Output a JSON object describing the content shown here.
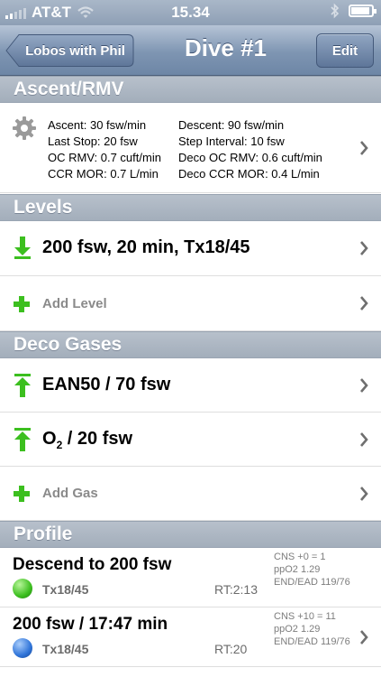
{
  "status_bar": {
    "carrier": "AT&T",
    "time": "15.34"
  },
  "nav": {
    "back_label": "Lobos with Phil",
    "title": "Dive #1",
    "edit_label": "Edit"
  },
  "sections": {
    "ascent": "Ascent/RMV",
    "levels": "Levels",
    "deco_gases": "Deco Gases",
    "profile": "Profile"
  },
  "ascent_rmv": {
    "left": [
      "Ascent: 30 fsw/min",
      "Last Stop: 20 fsw",
      "OC RMV: 0.7 cuft/min",
      "CCR MOR: 0.7 L/min"
    ],
    "right": [
      "Descent: 90 fsw/min",
      "Step Interval: 10 fsw",
      "Deco OC RMV: 0.6 cuft/min",
      "Deco CCR MOR: 0.4 L/min"
    ]
  },
  "levels": {
    "items": [
      {
        "label": "200 fsw, 20 min, Tx18/45"
      }
    ],
    "add_label": "Add Level"
  },
  "deco_gases": {
    "gas1": "EAN50 / 70 fsw",
    "gas2_prefix": "O",
    "gas2_sub": "2",
    "gas2_suffix": " / 20 fsw",
    "add_label": "Add Gas"
  },
  "profile": [
    {
      "title": "Descend to 200 fsw",
      "gas": "Tx18/45",
      "rt": "RT:2:13",
      "stats": [
        "CNS +0 = 1",
        "ppO2 1.29",
        "END/EAD 119/76"
      ],
      "dot_color": "#3cbf1f"
    },
    {
      "title": "200 fsw / 17:47 min",
      "gas": "Tx18/45",
      "rt": "RT:20",
      "stats": [
        "CNS +10 = 11",
        "ppO2 1.29",
        "END/EAD 119/76"
      ],
      "dot_color": "#2f74d9"
    }
  ],
  "colors": {
    "accent_green": "#3cbf1f",
    "nav_blue": "#7e95b2"
  }
}
